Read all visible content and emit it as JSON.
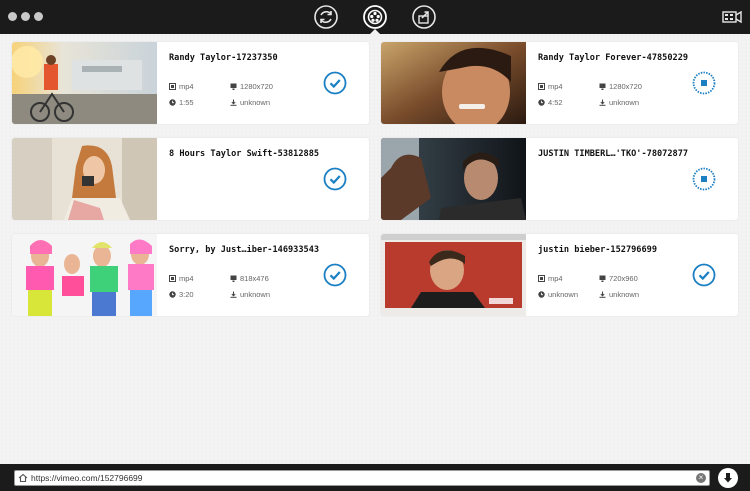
{
  "toolbar": {
    "icons": [
      "convert-icon",
      "download-icon",
      "share-icon"
    ],
    "right_icon": "screen-record-icon"
  },
  "cards": [
    {
      "title": "Randy Taylor-17237350",
      "format": "mp4",
      "resolution": "1280x720",
      "duration": "1:55",
      "size": "unknown",
      "status": "done"
    },
    {
      "title": "Randy Taylor Forever-47850229",
      "format": "mp4",
      "resolution": "1280x720",
      "duration": "4:52",
      "size": "unknown",
      "status": "downloading"
    },
    {
      "title": "8 Hours Taylor Swift-53812885",
      "status": "done"
    },
    {
      "title": "JUSTIN TIMBERL…'TKO'-78072877",
      "status": "downloading"
    },
    {
      "title": "Sorry, by Just…iber-146933543",
      "format": "mp4",
      "resolution": "818x476",
      "duration": "3:20",
      "size": "unknown",
      "status": "done"
    },
    {
      "title": "justin bieber-152796699",
      "format": "mp4",
      "resolution": "720x960",
      "duration": "unknown",
      "size": "unknown",
      "status": "done"
    }
  ],
  "url_bar": {
    "value": "https://vimeo.com/152796699"
  },
  "colors": {
    "accent": "#1b7fc4",
    "topbar": "#1b1b1b"
  }
}
